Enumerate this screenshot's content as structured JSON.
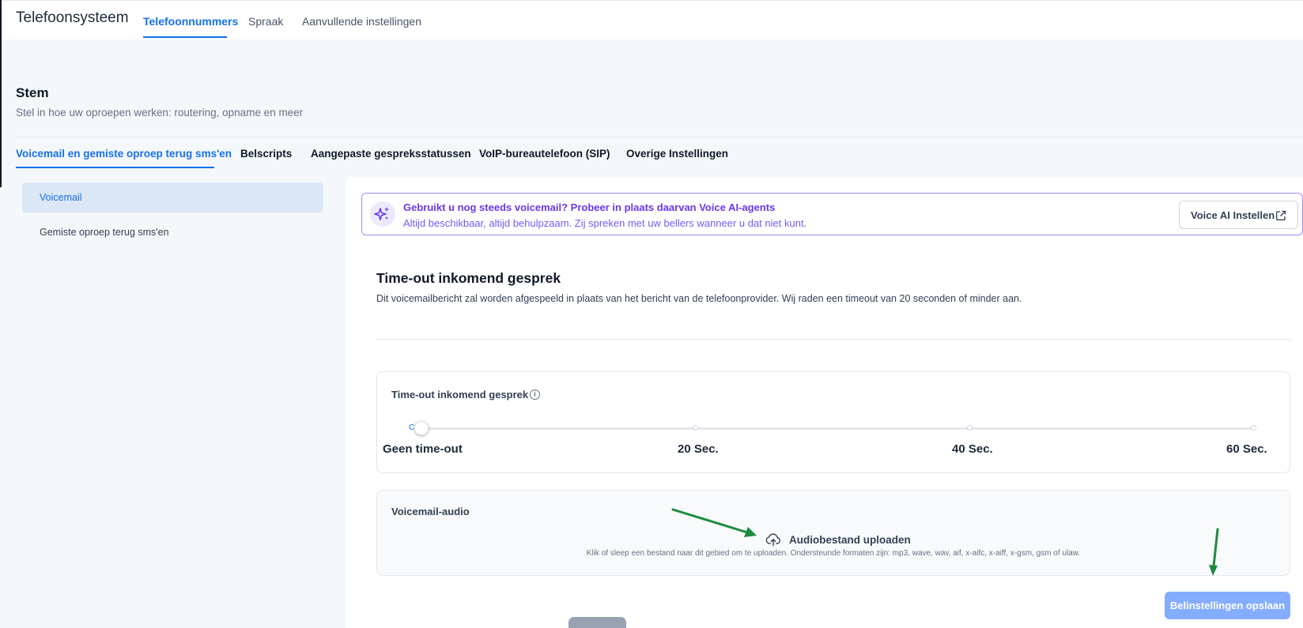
{
  "header": {
    "app_title": "Telefoonsysteem",
    "tabs": [
      {
        "label": "Telefoonnummers",
        "active": true
      },
      {
        "label": "Spraak",
        "active": false
      },
      {
        "label": "Aanvullende instellingen",
        "active": false
      }
    ]
  },
  "section": {
    "title": "Stem",
    "subtitle": "Stel in hoe uw oproepen werken: routering, opname en meer"
  },
  "subtabs": [
    {
      "label": "Voicemail en gemiste oproep terug sms'en",
      "active": true
    },
    {
      "label": "Belscripts",
      "active": false
    },
    {
      "label": "Aangepaste gespreksstatussen",
      "active": false
    },
    {
      "label": "VoIP-bureautelefoon (SIP)",
      "active": false
    },
    {
      "label": "Overige Instellingen",
      "active": false
    }
  ],
  "sidebar": {
    "items": [
      {
        "label": "Voicemail",
        "active": true
      },
      {
        "label": "Gemiste oproep terug sms'en",
        "active": false
      }
    ]
  },
  "banner": {
    "icon": "sparkles-icon",
    "title": "Gebruikt u nog steeds voicemail? Probeer in plaats daarvan Voice AI-agents",
    "subtitle": "Altijd beschikbaar, altijd behulpzaam. Zij spreken met uw bellers wanneer u dat niet kunt.",
    "button_label": "Voice AI Instellen",
    "button_icon": "external-link-icon"
  },
  "card": {
    "title": "Time-out inkomend gesprek",
    "description": "Dit voicemailbericht zal worden afgespeeld in plaats van het bericht van de telefoonprovider. Wij raden een timeout van 20 seconden of minder aan."
  },
  "timeout": {
    "label": "Time-out inkomend gesprek",
    "thumb_glyph": "C",
    "marks": [
      "Geen time-out",
      "20 Sec.",
      "40 Sec.",
      "60 Sec."
    ],
    "selected_index": 0
  },
  "voicemail_audio": {
    "label": "Voicemail-audio",
    "upload_label": "Audiobestand uploaden",
    "upload_help": "Klik of sleep een bestand naar dit gebied om te uploaden. Ondersteunde formaten zijn: mp3, wave, wav, aif, x-aifc, x-aiff, x-gsm, gsm of ulaw."
  },
  "footer": {
    "save_label": "Belinstellingen opslaan"
  },
  "colors": {
    "accent": "#1570ef",
    "banner_purple": "#6938ef",
    "annotation_arrow": "#1e8a3e",
    "save_button": "#84adff"
  }
}
